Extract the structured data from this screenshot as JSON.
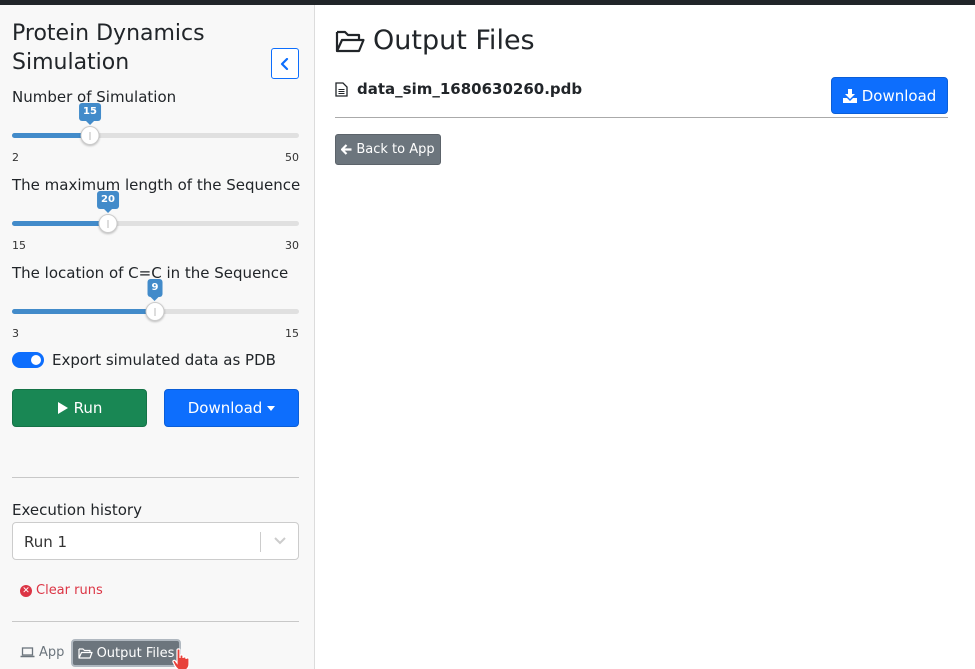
{
  "sidebar": {
    "title": "Protein Dynamics Simulation",
    "sliders": [
      {
        "label": "Number of Simulation",
        "value": "15",
        "min": "2",
        "max": "50",
        "fraction": 0.271
      },
      {
        "label": "The maximum length of the Sequence",
        "value": "20",
        "min": "15",
        "max": "30",
        "fraction": 0.333
      },
      {
        "label": "The location of C=C in the Sequence",
        "value": "9",
        "min": "3",
        "max": "15",
        "fraction": 0.5
      }
    ],
    "toggle_label": "Export simulated data as PDB",
    "toggle_on": true,
    "run_label": "Run",
    "download_label": "Download",
    "history_label": "Execution history",
    "history_value": "Run 1",
    "clear_label": "Clear runs",
    "nav_app_label": "App",
    "nav_output_label": "Output Files"
  },
  "main": {
    "title": "Output Files",
    "file_name": "data_sim_1680630260.pdb",
    "download_label": "Download",
    "back_label": "Back to App"
  },
  "colors": {
    "primary": "#0d6efd",
    "success": "#198754",
    "secondary": "#6c757d",
    "danger": "#dc3545",
    "slider": "#428bca"
  }
}
